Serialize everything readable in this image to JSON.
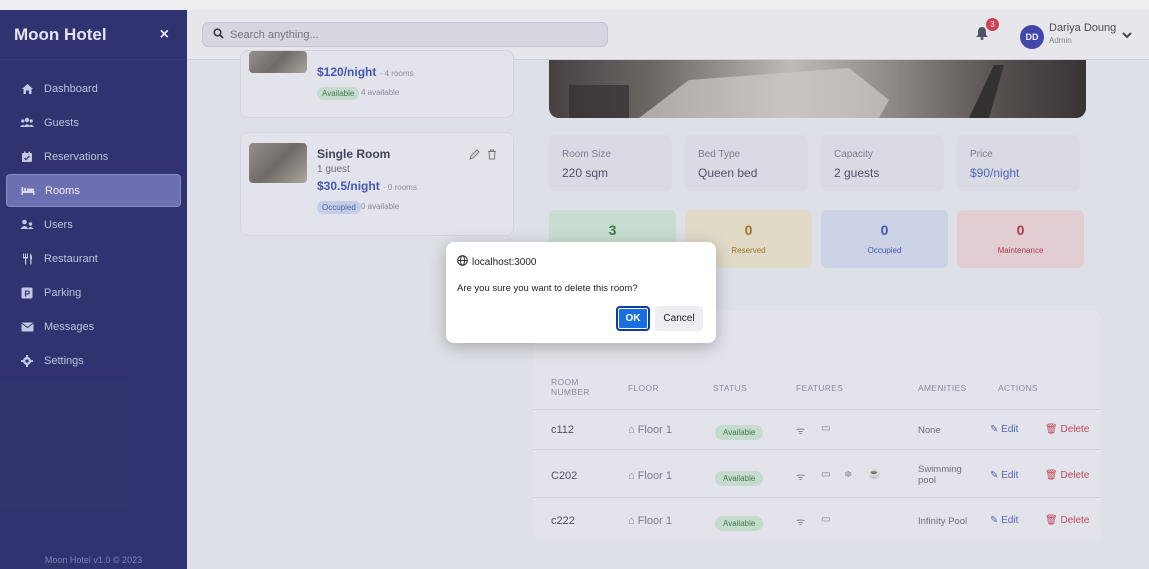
{
  "sidebar": {
    "brand": "Moon Hotel",
    "close": "×",
    "items": [
      {
        "label": "Dashboard",
        "icon": "home-icon"
      },
      {
        "label": "Guests",
        "icon": "guests-icon"
      },
      {
        "label": "Reservations",
        "icon": "calendar-icon"
      },
      {
        "label": "Rooms",
        "icon": "bed-icon",
        "active": true
      },
      {
        "label": "Users",
        "icon": "users-icon"
      },
      {
        "label": "Restaurant",
        "icon": "utensils-icon"
      },
      {
        "label": "Parking",
        "icon": "parking-icon"
      },
      {
        "label": "Messages",
        "icon": "envelope-icon"
      },
      {
        "label": "Settings",
        "icon": "gear-icon"
      }
    ],
    "footer": "Moon Hotel v1.0 © 2023"
  },
  "topbar": {
    "search_placeholder": "Search anything...",
    "notification_count": "3",
    "avatar_initials": "DD",
    "user_name": "Dariya Doung",
    "user_role": "Admin"
  },
  "rooms_list": [
    {
      "name": "",
      "price": "$120/night",
      "rooms": "· 4 rooms",
      "status": "Available",
      "available": "4 available"
    },
    {
      "name": "Single Room",
      "guests": "1 guest",
      "price": "$30.5/night",
      "rooms": "· 0 rooms",
      "status": "Occupied",
      "available": "0 available"
    }
  ],
  "room_details": {
    "stats": [
      {
        "label": "Room Size",
        "value": "220 sqm"
      },
      {
        "label": "Bed Type",
        "value": "Queen bed"
      },
      {
        "label": "Capacity",
        "value": "2 guests"
      },
      {
        "label": "Price",
        "value": "$90/night"
      }
    ],
    "counts": [
      {
        "value": "3",
        "label": "",
        "color": "#2f7a3f",
        "bg": "#d3ebd9"
      },
      {
        "value": "0",
        "label": "Reserved",
        "color": "#a07617",
        "bg": "#efe7cf"
      },
      {
        "value": "0",
        "label": "Occupied",
        "color": "#3b56b0",
        "bg": "#d6def2"
      },
      {
        "value": "0",
        "label": "Maintenance",
        "color": "#b53444",
        "bg": "#f1d9dc"
      }
    ]
  },
  "table": {
    "headers": [
      "ROOM NUMBER",
      "FLOOR",
      "STATUS",
      "FEATURES",
      "AMENITIES",
      "ACTIONS"
    ],
    "rows": [
      {
        "room": "c112",
        "floor": "Floor 1",
        "status": "Available",
        "amenities": "None",
        "features": [
          "wifi-icon",
          "tv-icon"
        ]
      },
      {
        "room": "C202",
        "floor": "Floor 1",
        "status": "Available",
        "amenities": "Swimming pool",
        "features": [
          "wifi-icon",
          "tv-icon",
          "ac-icon",
          "coffee-icon"
        ]
      },
      {
        "room": "c222",
        "floor": "Floor 1",
        "status": "Available",
        "amenities": "Infinity Pool",
        "features": [
          "wifi-icon",
          "tv-icon"
        ]
      }
    ],
    "edit_label": "Edit",
    "delete_label": "Delete"
  },
  "dialog": {
    "origin": "localhost:3000",
    "message": "Are you sure you want to delete this room?",
    "ok": "OK",
    "cancel": "Cancel"
  },
  "colors": {
    "sidebar_bg": "#262a6a",
    "accent": "#1a6fe0",
    "delete": "#c84454"
  }
}
